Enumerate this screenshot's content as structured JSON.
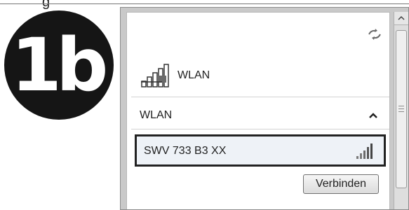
{
  "top_label": "g",
  "step_badge": {
    "label": "1b"
  },
  "wlan_panel": {
    "header_label": "WLAN",
    "group_label": "WLAN",
    "network": {
      "ssid": "SWV 733 B3 XX",
      "signal_bars": 5
    },
    "connect_button_label": "Verbinden"
  },
  "icons": {
    "refresh": "refresh-arrows-icon",
    "network": "wlan-signal-icon",
    "chevron": "chevron-up-icon",
    "signal": "signal-strength-icon"
  }
}
